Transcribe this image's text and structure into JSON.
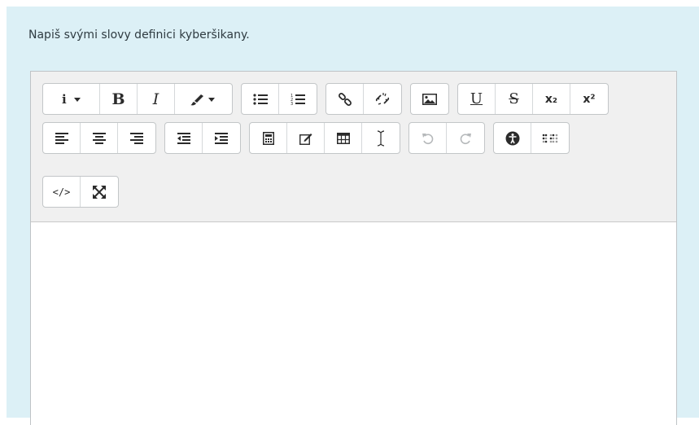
{
  "question": {
    "text": "Napiš svými slovy definici kyberšikany."
  },
  "toolbar": {
    "bold_label": "B",
    "italic_label": "I",
    "underline_label": "U",
    "strike_label": "S",
    "subscript_label": "x₂",
    "superscript_label": "x²",
    "html_label": "</>",
    "icons": {
      "info": "info-icon",
      "color": "paint-brush-icon",
      "bullets": "unordered-list-icon",
      "numbers": "ordered-list-icon",
      "link": "link-icon",
      "unlink": "unlink-icon",
      "image": "image-icon",
      "align_left": "align-left-icon",
      "align_center": "align-center-icon",
      "align_right": "align-right-icon",
      "outdent": "outdent-icon",
      "indent": "indent-icon",
      "equation": "calculator-icon",
      "edit": "pencil-square-icon",
      "table": "table-icon",
      "cursor": "text-cursor-icon",
      "undo": "undo-icon",
      "redo": "redo-icon",
      "accessibility": "accessibility-icon",
      "braille": "braille-icon",
      "fullscreen": "expand-icon"
    }
  },
  "editor": {
    "content": ""
  },
  "colors": {
    "panel_bg": "#dcf0f6",
    "toolbar_bg": "#f0f0f0",
    "disabled": "#b5b8ba"
  }
}
